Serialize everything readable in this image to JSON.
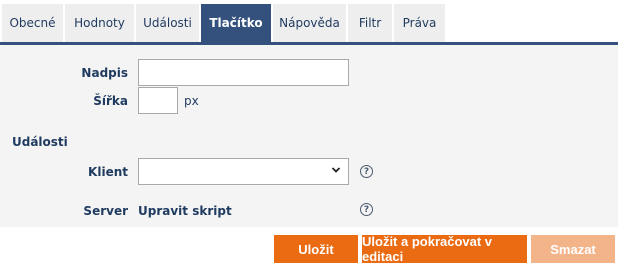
{
  "tabs": [
    {
      "label": "Obecné"
    },
    {
      "label": "Hodnoty"
    },
    {
      "label": "Události"
    },
    {
      "label": "Tlačítko",
      "active": true
    },
    {
      "label": "Nápověda"
    },
    {
      "label": "Filtr"
    },
    {
      "label": "Práva"
    }
  ],
  "form": {
    "title_label": "Nadpis",
    "title_value": "",
    "width_label": "Šířka",
    "width_value": "",
    "width_unit": "px",
    "events_heading": "Události",
    "client_label": "Klient",
    "client_selected": "",
    "server_label": "Server",
    "server_link": "Upravit skript",
    "help_glyph": "?"
  },
  "buttons": {
    "save": "Uložit",
    "save_continue": "Uložit a pokračovat v editaci",
    "delete": "Smazat"
  },
  "colors": {
    "accent": "#34507c",
    "action": "#ea6b12",
    "action_disabled": "#f4b48a"
  }
}
